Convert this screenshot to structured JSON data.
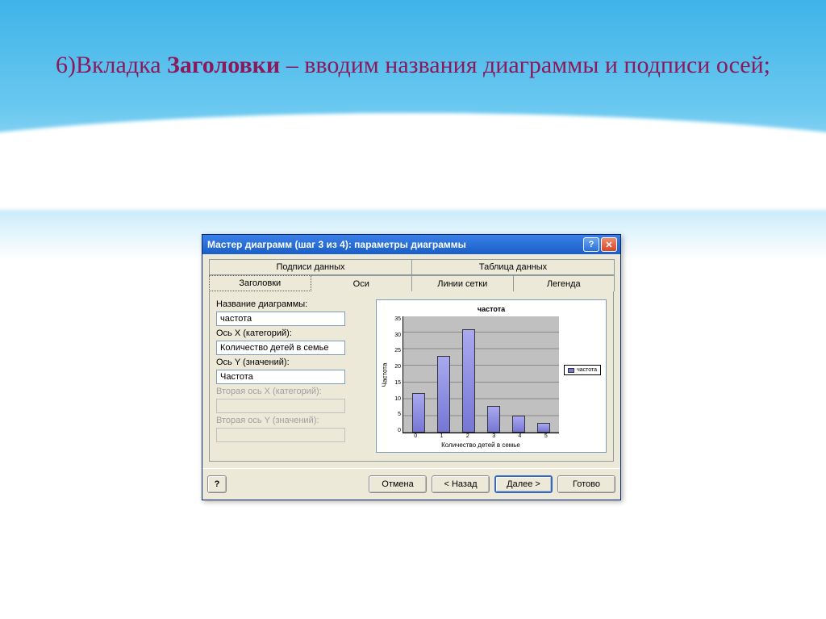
{
  "slide": {
    "title_prefix": "6)Вкладка ",
    "title_bold": "Заголовки",
    "title_rest": " – вводим названия диаграммы и подписи осей;"
  },
  "dialog": {
    "title": "Мастер диаграмм (шаг 3 из 4): параметры диаграммы",
    "help_glyph": "?",
    "close_glyph": "✕",
    "tabs_back": [
      "Подписи данных",
      "Таблица данных"
    ],
    "tabs_front": [
      "Заголовки",
      "Оси",
      "Линии сетки",
      "Легенда"
    ],
    "active_tab": "Заголовки",
    "fields": {
      "chart_title_label": "Название диаграммы:",
      "chart_title_value": "частота",
      "x_label": "Ось X (категорий):",
      "x_value": "Количество детей в семье",
      "y_label": "Ось Y (значений):",
      "y_value": "Частота",
      "x2_label": "Вторая ось X (категорий):",
      "x2_value": "",
      "y2_label": "Вторая ось Y (значений):",
      "y2_value": ""
    },
    "buttons": {
      "help": "?",
      "cancel": "Отмена",
      "back": "< Назад",
      "next": "Далее >",
      "finish": "Готово"
    }
  },
  "chart_data": {
    "type": "bar",
    "title": "частота",
    "xlabel": "Количество детей в семье",
    "ylabel": "Частота",
    "categories": [
      "0",
      "1",
      "2",
      "3",
      "4",
      "5"
    ],
    "values": [
      12,
      23,
      31,
      8,
      5,
      3
    ],
    "ylim": [
      0,
      35
    ],
    "yticks": [
      0,
      5,
      10,
      15,
      20,
      25,
      30,
      35
    ],
    "legend": [
      "частота"
    ]
  }
}
